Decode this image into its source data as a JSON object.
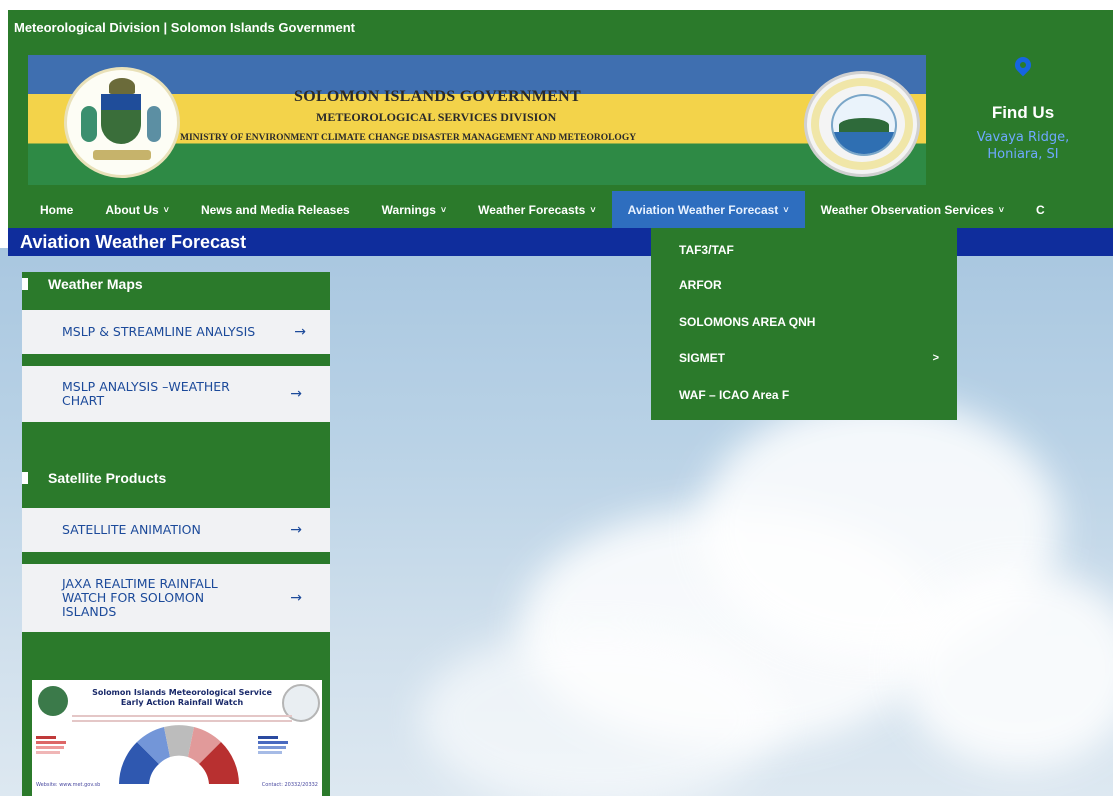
{
  "topbar": {
    "text": "Meteorological Division | Solomon Islands Government"
  },
  "banner": {
    "line1": "SOLOMON ISLANDS GOVERNMENT",
    "line2": "METEOROLOGICAL SERVICES DIVISION",
    "line3": "MINISTRY OF ENVIRONMENT CLIMATE CHANGE  DISASTER MANAGEMENT AND METEOROLOGY"
  },
  "find_us": {
    "title": "Find Us",
    "address_line1": "Vavaya Ridge,",
    "address_line2": "Honiara, SI",
    "icon": "map-pin-icon"
  },
  "nav": {
    "items": [
      {
        "label": "Home",
        "has_dropdown": false
      },
      {
        "label": "About Us",
        "has_dropdown": true
      },
      {
        "label": "News and Media Releases",
        "has_dropdown": false
      },
      {
        "label": "Warnings",
        "has_dropdown": true
      },
      {
        "label": "Weather Forecasts",
        "has_dropdown": true
      },
      {
        "label": "Aviation Weather Forecast",
        "has_dropdown": true,
        "active": true
      },
      {
        "label": "Weather Observation Services",
        "has_dropdown": true
      },
      {
        "label": "C",
        "has_dropdown": false
      }
    ],
    "chevron": "˅"
  },
  "page_title": "Aviation Weather Forecast",
  "dropdown": {
    "items": [
      {
        "label": "TAF3/TAF"
      },
      {
        "label": "ARFOR"
      },
      {
        "label": "SOLOMONS AREA QNH"
      },
      {
        "label": "SIGMET",
        "submenu_arrow": ">"
      },
      {
        "label": "WAF – ICAO Area F"
      }
    ]
  },
  "sidebar": {
    "weather_maps": {
      "heading": "Weather Maps",
      "links": [
        {
          "label": "MSLP & STREAMLINE ANALYSIS",
          "arrow": "→"
        },
        {
          "label": "MSLP ANALYSIS –WEATHER CHART",
          "arrow": "→"
        }
      ]
    },
    "satellite": {
      "heading": "Satellite Products",
      "links": [
        {
          "label": "SATELLITE ANIMATION",
          "arrow": "→"
        },
        {
          "label": "JAXA REALTIME RAINFALL WATCH FOR SOLOMON ISLANDS",
          "arrow": "→"
        }
      ]
    },
    "rainfall_image": {
      "title_line1": "Solomon Islands Meteorological Service",
      "title_line2": "Early Action Rainfall Watch",
      "website": "Website: www.met.gov.sb",
      "contact": "Contact: 20332/20332"
    }
  },
  "colors": {
    "green": "#2b7a2b",
    "title_blue": "#0f2d9c",
    "active_nav": "#2e6ebf",
    "link_blue": "#1c4a9a",
    "address_blue": "#6fa8ff"
  }
}
